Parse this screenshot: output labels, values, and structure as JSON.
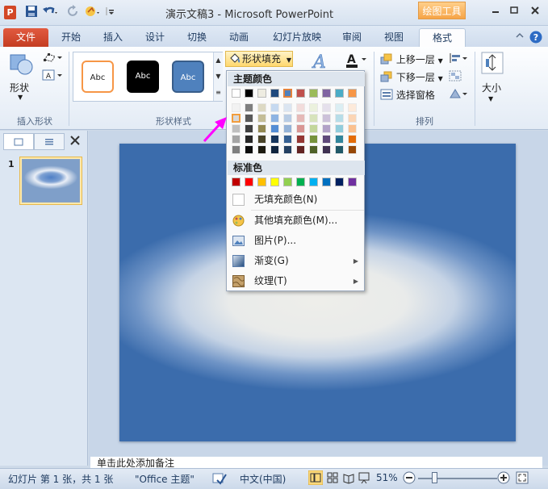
{
  "titlebar": {
    "app_icon": "P",
    "title": "演示文稿3 - Microsoft PowerPoint",
    "context_tab_title": "绘图工具",
    "icons": [
      "save-icon",
      "undo-icon",
      "redo-icon",
      "touch-mode-icon",
      "customize-qat-icon"
    ],
    "window_buttons": [
      "minimize-icon",
      "restore-icon",
      "close-icon"
    ]
  },
  "tabs": [
    "文件",
    "开始",
    "插入",
    "设计",
    "切换",
    "动画",
    "幻灯片放映",
    "审阅",
    "视图",
    "格式"
  ],
  "ribbon": {
    "insert_shapes": {
      "label": "形状",
      "group_label": "插入形状"
    },
    "shape_styles": {
      "group_label": "形状样式",
      "sample_text": "Abc",
      "fill_button": "形状填充"
    },
    "arrange": {
      "group_label": "排列",
      "bring_forward": "上移一层",
      "send_backward": "下移一层",
      "selection_pane": "选择窗格"
    },
    "size": {
      "label": "大小"
    }
  },
  "fill_menu": {
    "theme_colors_header": "主题颜色",
    "theme_top": [
      "#ffffff",
      "#000000",
      "#eeece1",
      "#1f497d",
      "#4f81bd",
      "#c0504d",
      "#9bbb59",
      "#8064a2",
      "#4bacc6",
      "#f79646"
    ],
    "theme_shades": [
      [
        "#f2f2f2",
        "#d8d8d8",
        "#bfbfbf",
        "#a5a5a5",
        "#7f7f7f"
      ],
      [
        "#7f7f7f",
        "#595959",
        "#3f3f3f",
        "#262626",
        "#0c0c0c"
      ],
      [
        "#ddd9c3",
        "#c4bd97",
        "#938953",
        "#494429",
        "#1d1b10"
      ],
      [
        "#c6d9f0",
        "#8db3e2",
        "#548dd4",
        "#17365d",
        "#0f243e"
      ],
      [
        "#dbe5f1",
        "#b8cce4",
        "#95b3d7",
        "#366092",
        "#244061"
      ],
      [
        "#f2dcdb",
        "#e5b9b7",
        "#d99694",
        "#953734",
        "#632423"
      ],
      [
        "#ebf1dd",
        "#d7e3bc",
        "#c3d69b",
        "#76923c",
        "#4f6128"
      ],
      [
        "#e5e0ec",
        "#ccc1d9",
        "#b2a2c7",
        "#5f497a",
        "#3f3151"
      ],
      [
        "#dbeef3",
        "#b7dde8",
        "#92cddc",
        "#31859b",
        "#205867"
      ],
      [
        "#fdeada",
        "#fbd5b5",
        "#fac08f",
        "#e36c09",
        "#974806"
      ]
    ],
    "standard_colors_header": "标准色",
    "standard_colors": [
      "#c00000",
      "#ff0000",
      "#ffc000",
      "#ffff00",
      "#92d050",
      "#00b050",
      "#00b0f0",
      "#0070c0",
      "#002060",
      "#7030a0"
    ],
    "items": [
      {
        "label": "无填充颜色(N)",
        "icon": "no-fill-icon"
      },
      {
        "label": "其他填充颜色(M)...",
        "icon": "color-palette-icon"
      },
      {
        "label": "图片(P)...",
        "icon": "picture-icon"
      },
      {
        "label": "渐变(G)",
        "icon": "gradient-icon",
        "submenu": true
      },
      {
        "label": "纹理(T)",
        "icon": "texture-icon",
        "submenu": true
      }
    ]
  },
  "slides_panel": {
    "slide_number": "1"
  },
  "notes_placeholder": "单击此处添加备注",
  "statusbar": {
    "slide_info": "幻灯片 第 1 张，共 1 张",
    "theme": "\"Office 主题\"",
    "language": "中文(中国)",
    "zoom": "51%"
  }
}
